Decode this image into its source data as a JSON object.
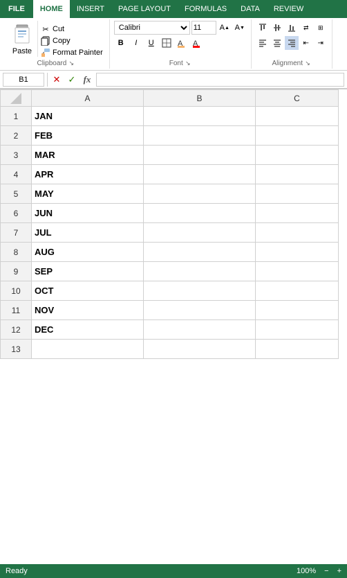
{
  "tabs": {
    "file": "FILE",
    "home": "HOME",
    "insert": "INSERT",
    "page_layout": "PAGE LAYOUT",
    "formulas": "FORMULAS",
    "data": "DATA",
    "review": "REVIEW"
  },
  "clipboard": {
    "paste_label": "Paste",
    "cut_label": "Cut",
    "copy_label": "Copy",
    "format_painter_label": "Format Painter",
    "group_label": "Clipboard"
  },
  "font": {
    "name": "Calibri",
    "size": "11",
    "bold": "B",
    "italic": "I",
    "underline": "U",
    "group_label": "Font"
  },
  "alignment": {
    "group_label": "Alignment"
  },
  "formula_bar": {
    "cell_ref": "B1",
    "fx": "fx",
    "cancel": "✕",
    "confirm": "✓"
  },
  "spreadsheet": {
    "columns": [
      "A",
      "B",
      "C"
    ],
    "rows": [
      {
        "num": 1,
        "a": "JAN",
        "b": "",
        "c": ""
      },
      {
        "num": 2,
        "a": "FEB",
        "b": "",
        "c": ""
      },
      {
        "num": 3,
        "a": "MAR",
        "b": "",
        "c": ""
      },
      {
        "num": 4,
        "a": "APR",
        "b": "",
        "c": ""
      },
      {
        "num": 5,
        "a": "MAY",
        "b": "",
        "c": ""
      },
      {
        "num": 6,
        "a": "JUN",
        "b": "",
        "c": ""
      },
      {
        "num": 7,
        "a": "JUL",
        "b": "",
        "c": ""
      },
      {
        "num": 8,
        "a": "AUG",
        "b": "",
        "c": ""
      },
      {
        "num": 9,
        "a": "SEP",
        "b": "",
        "c": ""
      },
      {
        "num": 10,
        "a": "OCT",
        "b": "",
        "c": ""
      },
      {
        "num": 11,
        "a": "NOV",
        "b": "",
        "c": ""
      },
      {
        "num": 12,
        "a": "DEC",
        "b": "",
        "c": ""
      },
      {
        "num": 13,
        "a": "",
        "b": "",
        "c": ""
      }
    ]
  },
  "status": {
    "mode": "Ready",
    "zoom": "100%"
  }
}
